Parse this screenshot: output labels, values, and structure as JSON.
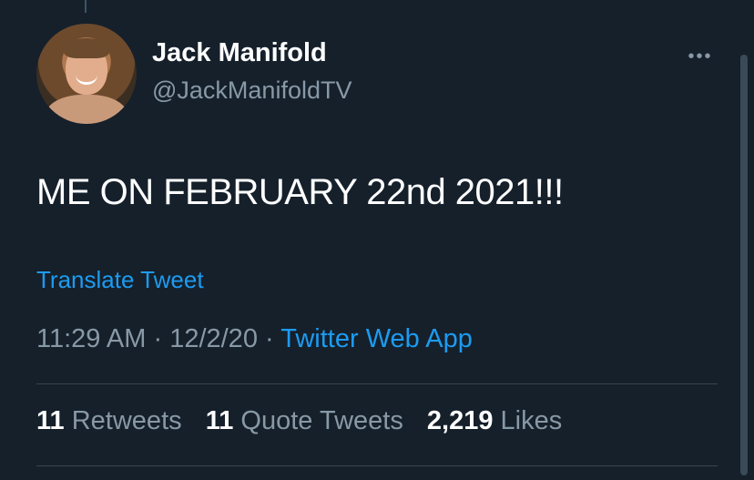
{
  "user": {
    "display_name": "Jack Manifold",
    "handle": "@JackManifoldTV"
  },
  "menu": {
    "more_label": "•••"
  },
  "tweet": {
    "text": "ME ON FEBRUARY 22nd 2021!!!",
    "translate_label": "Translate Tweet",
    "time": "11:29 AM",
    "separator": "·",
    "date": "12/2/20",
    "source": "Twitter Web App"
  },
  "stats": {
    "retweets_count": "11",
    "retweets_label": "Retweets",
    "quotes_count": "11",
    "quotes_label": "Quote Tweets",
    "likes_count": "2,219",
    "likes_label": "Likes"
  },
  "colors": {
    "background": "#15202b",
    "link": "#1d9bf0",
    "secondary_text": "#8899a6",
    "divider": "#38444d"
  }
}
